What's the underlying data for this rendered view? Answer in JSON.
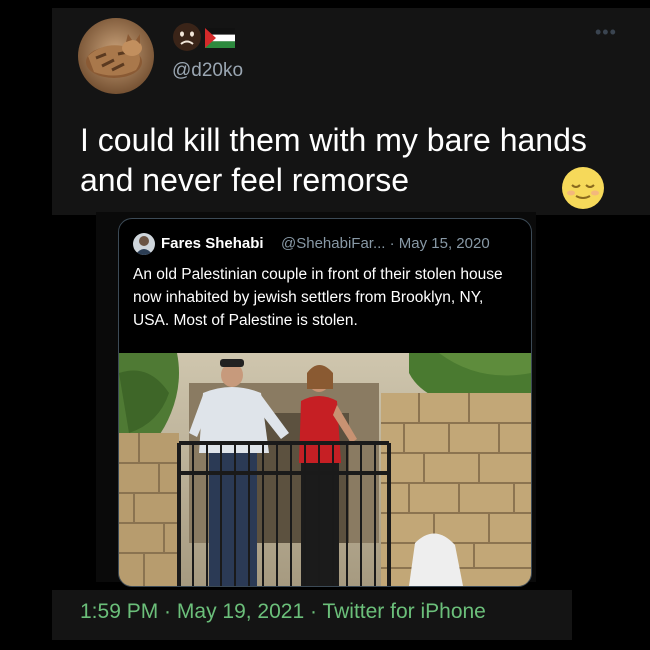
{
  "tweet": {
    "handle": "@d20ko",
    "more_icon": "•••",
    "text": "I could kill them with my bare hands and never feel remorse"
  },
  "quoted": {
    "author_name": "Fares Shehabi",
    "meta": "@ShehabiFar... · May 15, 2020",
    "text": "An old Palestinian couple in front of their stolen house now inhabited by jewish settlers from Brooklyn, NY, USA. Most of Palestine is stolen."
  },
  "footer": {
    "time": "1:59 PM",
    "sep": " · ",
    "date": "May 19, 2021",
    "source": "Twitter for iPhone"
  },
  "icons": {
    "avatar": "cat-avatar-icon",
    "emoji": "frowning-face-icon",
    "flag": "palestine-flag-icon",
    "relieved": "relieved-face-icon"
  },
  "colors": {
    "background": "#000000",
    "handle": "#9aa6b2",
    "footer_text": "#6bbf7a",
    "quote_border": "#3c4a56"
  }
}
